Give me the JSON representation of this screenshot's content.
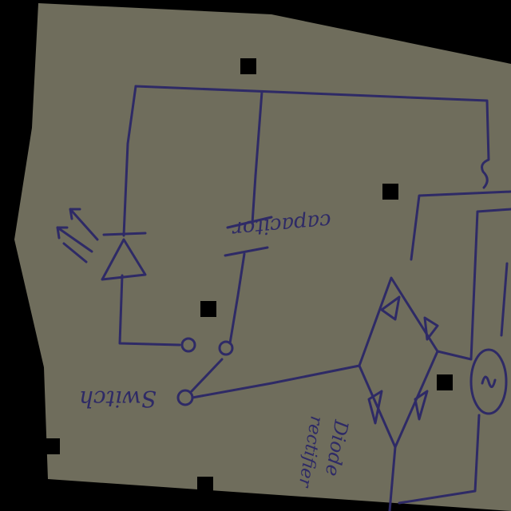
{
  "diagram": {
    "title": "Hand-drawn LED circuit with diode bridge rectifier",
    "labels": {
      "capacitor": "capacitor",
      "switch": "Switch",
      "rectifier_line1": "Diode",
      "rectifier_line2": "rectifier"
    },
    "colors": {
      "paper": "#6f6d5c",
      "ink": "#2e2a66",
      "background": "#000000"
    }
  }
}
